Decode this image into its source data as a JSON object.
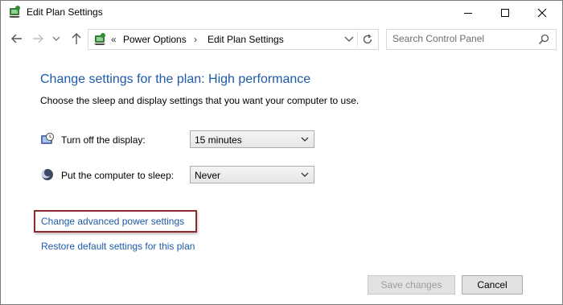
{
  "window": {
    "title": "Edit Plan Settings"
  },
  "nav": {
    "breadcrumb_sep": "«",
    "crumbs": [
      "Power Options",
      "Edit Plan Settings"
    ],
    "crumb_arrow": "›",
    "search_placeholder": "Search Control Panel"
  },
  "content": {
    "heading": "Change settings for the plan: High performance",
    "subtitle": "Choose the sleep and display settings that you want your computer to use.",
    "display": {
      "label": "Turn off the display:",
      "value": "15 minutes"
    },
    "sleep": {
      "label": "Put the computer to sleep:",
      "value": "Never"
    },
    "links": {
      "advanced": "Change advanced power settings",
      "restore": "Restore default settings for this plan"
    }
  },
  "footer": {
    "save_label": "Save changes",
    "cancel_label": "Cancel"
  },
  "colors": {
    "link": "#1e5aa8",
    "highlight_box": "#8b2a2f"
  }
}
